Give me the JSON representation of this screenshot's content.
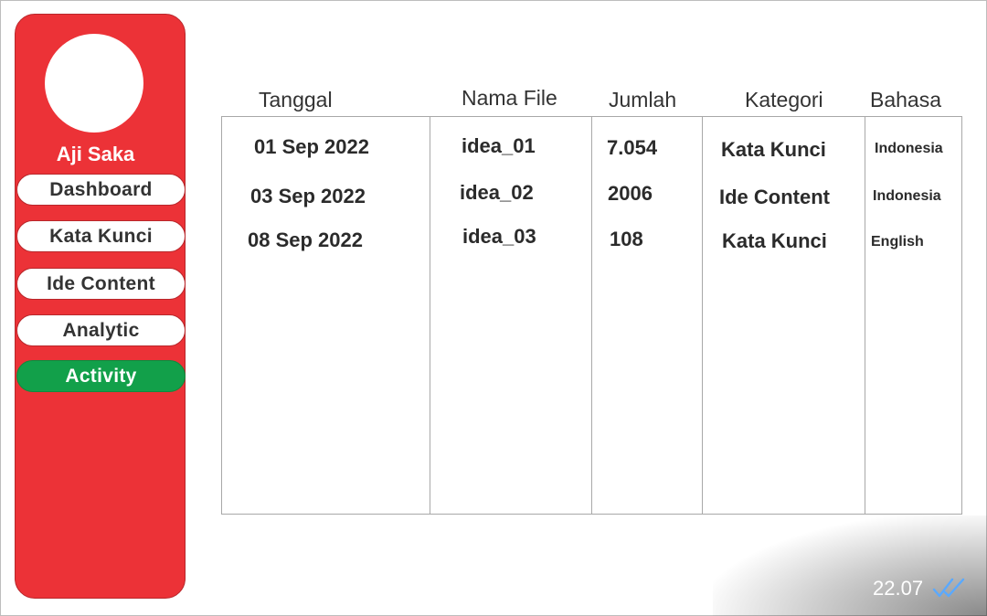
{
  "sidebar": {
    "username": "Aji Saka",
    "items": [
      {
        "label": "Dashboard"
      },
      {
        "label": "Kata Kunci"
      },
      {
        "label": "Ide Content"
      },
      {
        "label": "Analytic"
      },
      {
        "label": "Activity"
      }
    ],
    "active_item": "Activity"
  },
  "table": {
    "headers": [
      "Tanggal",
      "Nama File",
      "Jumlah",
      "Kategori",
      "Bahasa"
    ],
    "rows": [
      [
        "01 Sep 2022",
        "idea_01",
        "7.054",
        "Kata Kunci",
        "Indonesia"
      ],
      [
        "03 Sep 2022",
        "idea_02",
        "2006",
        "Ide Content",
        "Indonesia"
      ],
      [
        "08 Sep 2022",
        "idea_03",
        "108",
        "Kata Kunci",
        "English"
      ]
    ]
  },
  "message_status": {
    "time": "22.07",
    "read_icon": "double-check-icon"
  },
  "colors": {
    "sidebar": "#ec3237",
    "active": "#12a04a",
    "read_tick": "#5aa9ff"
  }
}
